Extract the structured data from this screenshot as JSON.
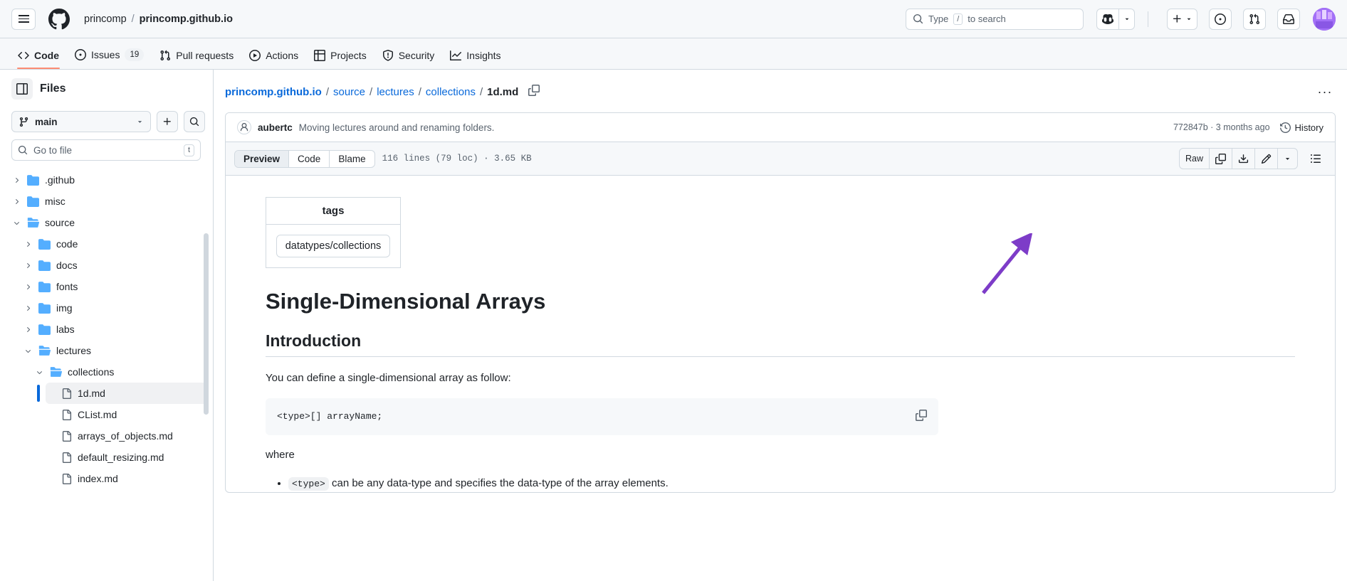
{
  "header": {
    "hamburger_label": "Open global navigation menu",
    "logo": "github-logo",
    "owner": "princomp",
    "separator": "/",
    "repo": "princomp.github.io",
    "search_placeholder": "Type",
    "search_key": "/",
    "search_suffix": "to search",
    "copilot_label": "Copilot",
    "create_new_label": "+",
    "issues_label": "Issues",
    "pull_requests_label": "Pull requests",
    "inbox_label": "Inbox",
    "avatar_label": "Your profile"
  },
  "repo_nav": [
    {
      "label": "Code",
      "icon": "code-icon",
      "active": true,
      "count": null
    },
    {
      "label": "Issues",
      "icon": "issue-opened-icon",
      "active": false,
      "count": "19"
    },
    {
      "label": "Pull requests",
      "icon": "git-pull-request-icon",
      "active": false,
      "count": null
    },
    {
      "label": "Actions",
      "icon": "play-icon",
      "active": false,
      "count": null
    },
    {
      "label": "Projects",
      "icon": "table-icon",
      "active": false,
      "count": null
    },
    {
      "label": "Security",
      "icon": "shield-icon",
      "active": false,
      "count": null
    },
    {
      "label": "Insights",
      "icon": "graph-icon",
      "active": false,
      "count": null
    }
  ],
  "sidebar": {
    "panel_toggle_label": "Hide file tree",
    "title": "Files",
    "branch": "main",
    "add_file_label": "+",
    "search_label": "Search this repository",
    "go_to_file_placeholder": "Go to file",
    "go_to_file_key": "t",
    "tree": [
      {
        "label": ".github",
        "type": "folder",
        "depth": 0,
        "expanded": false,
        "selected": false
      },
      {
        "label": "misc",
        "type": "folder",
        "depth": 0,
        "expanded": false,
        "selected": false
      },
      {
        "label": "source",
        "type": "folder",
        "depth": 0,
        "expanded": true,
        "selected": false
      },
      {
        "label": "code",
        "type": "folder",
        "depth": 1,
        "expanded": false,
        "selected": false
      },
      {
        "label": "docs",
        "type": "folder",
        "depth": 1,
        "expanded": false,
        "selected": false
      },
      {
        "label": "fonts",
        "type": "folder",
        "depth": 1,
        "expanded": false,
        "selected": false
      },
      {
        "label": "img",
        "type": "folder",
        "depth": 1,
        "expanded": false,
        "selected": false
      },
      {
        "label": "labs",
        "type": "folder",
        "depth": 1,
        "expanded": false,
        "selected": false
      },
      {
        "label": "lectures",
        "type": "folder",
        "depth": 1,
        "expanded": true,
        "selected": false
      },
      {
        "label": "collections",
        "type": "folder",
        "depth": 2,
        "expanded": true,
        "selected": false
      },
      {
        "label": "1d.md",
        "type": "file",
        "depth": 3,
        "expanded": false,
        "selected": true
      },
      {
        "label": "CList.md",
        "type": "file",
        "depth": 3,
        "expanded": false,
        "selected": false
      },
      {
        "label": "arrays_of_objects.md",
        "type": "file",
        "depth": 3,
        "expanded": false,
        "selected": false
      },
      {
        "label": "default_resizing.md",
        "type": "file",
        "depth": 3,
        "expanded": false,
        "selected": false
      },
      {
        "label": "index.md",
        "type": "file",
        "depth": 3,
        "expanded": false,
        "selected": false
      }
    ]
  },
  "breadcrumb": {
    "items": [
      {
        "label": "princomp.github.io",
        "current": false
      },
      {
        "label": "source",
        "current": false
      },
      {
        "label": "lectures",
        "current": false
      },
      {
        "label": "collections",
        "current": false
      },
      {
        "label": "1d.md",
        "current": true
      }
    ],
    "separator": "/",
    "copy_path_label": "Copy path",
    "more_options_label": "More file actions"
  },
  "commit": {
    "author": "aubertc",
    "message": "Moving lectures around and renaming folders.",
    "sha": "772847b",
    "sha_sep": "·",
    "relative_time": "3 months ago",
    "history_label": "History"
  },
  "file_toolbar": {
    "views": [
      {
        "label": "Preview",
        "active": true
      },
      {
        "label": "Code",
        "active": false
      },
      {
        "label": "Blame",
        "active": false
      }
    ],
    "file_meta": "116 lines (79 loc) · 3.65 KB",
    "raw_label": "Raw",
    "copy_label": "Copy raw content",
    "download_label": "Download raw content",
    "edit_label": "Edit this file",
    "edit_dropdown_label": "More edit options",
    "outline_label": "Open symbols panel"
  },
  "annotation": {
    "arrow_color": "#7d3cc8",
    "points_to": "edit-file-button"
  },
  "document": {
    "tags_table": {
      "header": "tags",
      "rows": [
        "datatypes/collections"
      ]
    },
    "title": "Single-Dimensional Arrays",
    "section_heading": "Introduction",
    "intro_paragraph": "You can define a single-dimensional array as follow:",
    "code_block": "<type>[] arrayName;",
    "code_copy_label": "Copy",
    "where_label": "where",
    "bullets": [
      {
        "code": "<type>",
        "text": " can be any data-type and specifies the data-type of the array elements."
      }
    ]
  }
}
